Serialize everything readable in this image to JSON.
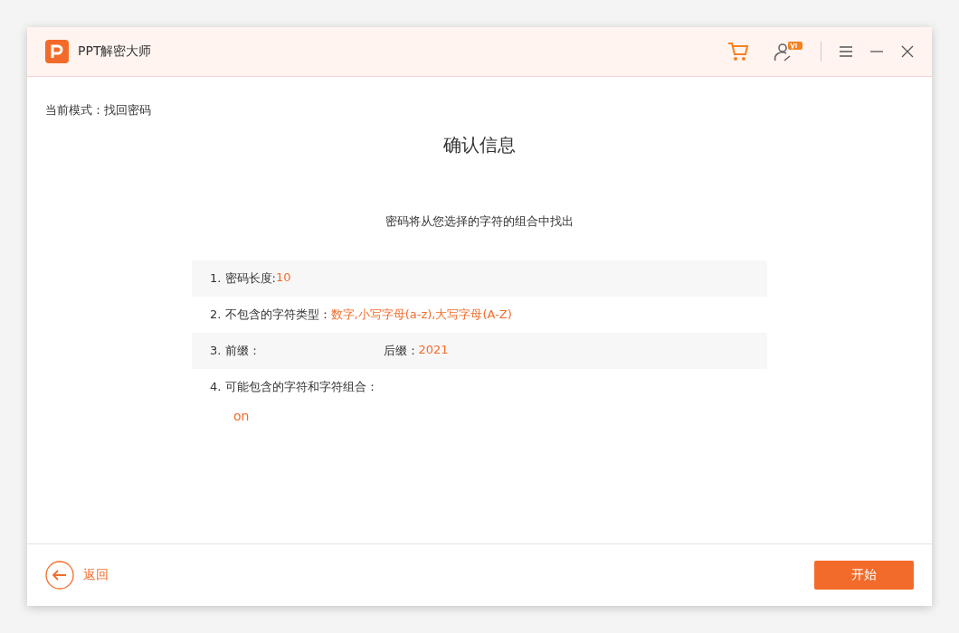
{
  "window": {
    "title": "PPT解密大师"
  },
  "mode": "当前模式：找回密码",
  "heading": "确认信息",
  "subtitle": "密码将从您选择的字符的组合中找出",
  "rows": [
    {
      "items": [
        {
          "label": "1. 密码长度:",
          "value": "10"
        }
      ]
    },
    {
      "items": [
        {
          "label": "2. 不包含的字符类型：",
          "value": "数字,小写字母(a-z),大写字母(A-Z)"
        }
      ]
    },
    {
      "items": [
        {
          "label": "3. 前缀："
        },
        {
          "label": "后缀：",
          "value": "2021"
        }
      ]
    },
    {
      "items": [
        {
          "label": "4. 可能包含的字符和字符组合："
        }
      ],
      "combinations": [
        "on"
      ]
    }
  ],
  "back": "返回",
  "start": "开始"
}
